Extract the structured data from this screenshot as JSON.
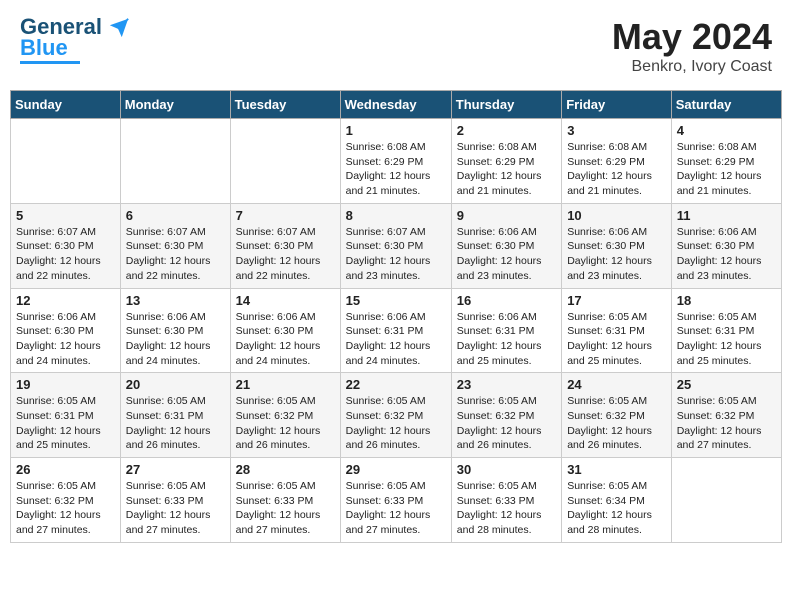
{
  "header": {
    "logo_line1": "General",
    "logo_line2": "Blue",
    "title": "May 2024",
    "location": "Benkro, Ivory Coast"
  },
  "weekdays": [
    "Sunday",
    "Monday",
    "Tuesday",
    "Wednesday",
    "Thursday",
    "Friday",
    "Saturday"
  ],
  "weeks": [
    [
      {
        "day": "",
        "info": ""
      },
      {
        "day": "",
        "info": ""
      },
      {
        "day": "",
        "info": ""
      },
      {
        "day": "1",
        "info": "Sunrise: 6:08 AM\nSunset: 6:29 PM\nDaylight: 12 hours\nand 21 minutes."
      },
      {
        "day": "2",
        "info": "Sunrise: 6:08 AM\nSunset: 6:29 PM\nDaylight: 12 hours\nand 21 minutes."
      },
      {
        "day": "3",
        "info": "Sunrise: 6:08 AM\nSunset: 6:29 PM\nDaylight: 12 hours\nand 21 minutes."
      },
      {
        "day": "4",
        "info": "Sunrise: 6:08 AM\nSunset: 6:29 PM\nDaylight: 12 hours\nand 21 minutes."
      }
    ],
    [
      {
        "day": "5",
        "info": "Sunrise: 6:07 AM\nSunset: 6:30 PM\nDaylight: 12 hours\nand 22 minutes."
      },
      {
        "day": "6",
        "info": "Sunrise: 6:07 AM\nSunset: 6:30 PM\nDaylight: 12 hours\nand 22 minutes."
      },
      {
        "day": "7",
        "info": "Sunrise: 6:07 AM\nSunset: 6:30 PM\nDaylight: 12 hours\nand 22 minutes."
      },
      {
        "day": "8",
        "info": "Sunrise: 6:07 AM\nSunset: 6:30 PM\nDaylight: 12 hours\nand 23 minutes."
      },
      {
        "day": "9",
        "info": "Sunrise: 6:06 AM\nSunset: 6:30 PM\nDaylight: 12 hours\nand 23 minutes."
      },
      {
        "day": "10",
        "info": "Sunrise: 6:06 AM\nSunset: 6:30 PM\nDaylight: 12 hours\nand 23 minutes."
      },
      {
        "day": "11",
        "info": "Sunrise: 6:06 AM\nSunset: 6:30 PM\nDaylight: 12 hours\nand 23 minutes."
      }
    ],
    [
      {
        "day": "12",
        "info": "Sunrise: 6:06 AM\nSunset: 6:30 PM\nDaylight: 12 hours\nand 24 minutes."
      },
      {
        "day": "13",
        "info": "Sunrise: 6:06 AM\nSunset: 6:30 PM\nDaylight: 12 hours\nand 24 minutes."
      },
      {
        "day": "14",
        "info": "Sunrise: 6:06 AM\nSunset: 6:30 PM\nDaylight: 12 hours\nand 24 minutes."
      },
      {
        "day": "15",
        "info": "Sunrise: 6:06 AM\nSunset: 6:31 PM\nDaylight: 12 hours\nand 24 minutes."
      },
      {
        "day": "16",
        "info": "Sunrise: 6:06 AM\nSunset: 6:31 PM\nDaylight: 12 hours\nand 25 minutes."
      },
      {
        "day": "17",
        "info": "Sunrise: 6:05 AM\nSunset: 6:31 PM\nDaylight: 12 hours\nand 25 minutes."
      },
      {
        "day": "18",
        "info": "Sunrise: 6:05 AM\nSunset: 6:31 PM\nDaylight: 12 hours\nand 25 minutes."
      }
    ],
    [
      {
        "day": "19",
        "info": "Sunrise: 6:05 AM\nSunset: 6:31 PM\nDaylight: 12 hours\nand 25 minutes."
      },
      {
        "day": "20",
        "info": "Sunrise: 6:05 AM\nSunset: 6:31 PM\nDaylight: 12 hours\nand 26 minutes."
      },
      {
        "day": "21",
        "info": "Sunrise: 6:05 AM\nSunset: 6:32 PM\nDaylight: 12 hours\nand 26 minutes."
      },
      {
        "day": "22",
        "info": "Sunrise: 6:05 AM\nSunset: 6:32 PM\nDaylight: 12 hours\nand 26 minutes."
      },
      {
        "day": "23",
        "info": "Sunrise: 6:05 AM\nSunset: 6:32 PM\nDaylight: 12 hours\nand 26 minutes."
      },
      {
        "day": "24",
        "info": "Sunrise: 6:05 AM\nSunset: 6:32 PM\nDaylight: 12 hours\nand 26 minutes."
      },
      {
        "day": "25",
        "info": "Sunrise: 6:05 AM\nSunset: 6:32 PM\nDaylight: 12 hours\nand 27 minutes."
      }
    ],
    [
      {
        "day": "26",
        "info": "Sunrise: 6:05 AM\nSunset: 6:32 PM\nDaylight: 12 hours\nand 27 minutes."
      },
      {
        "day": "27",
        "info": "Sunrise: 6:05 AM\nSunset: 6:33 PM\nDaylight: 12 hours\nand 27 minutes."
      },
      {
        "day": "28",
        "info": "Sunrise: 6:05 AM\nSunset: 6:33 PM\nDaylight: 12 hours\nand 27 minutes."
      },
      {
        "day": "29",
        "info": "Sunrise: 6:05 AM\nSunset: 6:33 PM\nDaylight: 12 hours\nand 27 minutes."
      },
      {
        "day": "30",
        "info": "Sunrise: 6:05 AM\nSunset: 6:33 PM\nDaylight: 12 hours\nand 28 minutes."
      },
      {
        "day": "31",
        "info": "Sunrise: 6:05 AM\nSunset: 6:34 PM\nDaylight: 12 hours\nand 28 minutes."
      },
      {
        "day": "",
        "info": ""
      }
    ]
  ]
}
